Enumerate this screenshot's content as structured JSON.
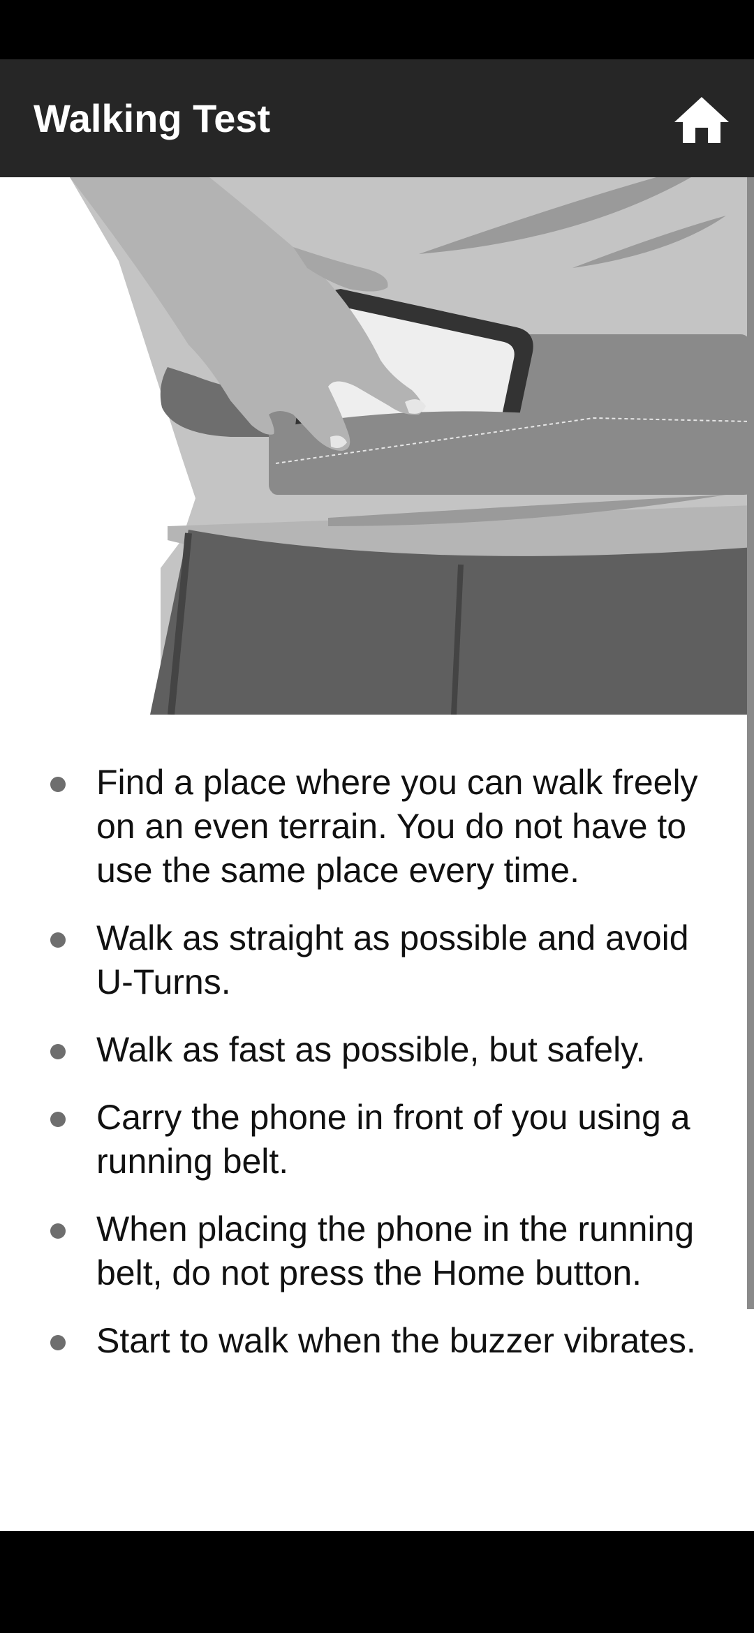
{
  "app_bar": {
    "title": "Walking Test",
    "home_icon": "home-icon"
  },
  "illustration": {
    "subject": "hand placing phone into running belt",
    "colors": {
      "background": "#ffffff",
      "shirt": "#c4c4c4",
      "trousers": "#5f5f5f",
      "belt": "#8a8a8a",
      "hand": "#b3b3b3",
      "phone_screen": "#eeeeee",
      "phone_body": "#333333"
    }
  },
  "instructions": [
    {
      "text": "Find a place where you can walk freely on an even terrain. You do not have to use the same place every time."
    },
    {
      "text": "Walk as straight as possible and avoid U-Turns."
    },
    {
      "text": "Walk as fast as possible, but safely."
    },
    {
      "text": "Carry the phone in front of you using a running belt."
    },
    {
      "text": "When placing the phone in the running belt, do not press the Home button."
    },
    {
      "text": "Start to walk when the buzzer vibrates."
    }
  ],
  "colors": {
    "app_bar": "#262626",
    "text": "#111111",
    "bullet": "#6e6e6e",
    "scrollbar": "#8a8a8a"
  }
}
